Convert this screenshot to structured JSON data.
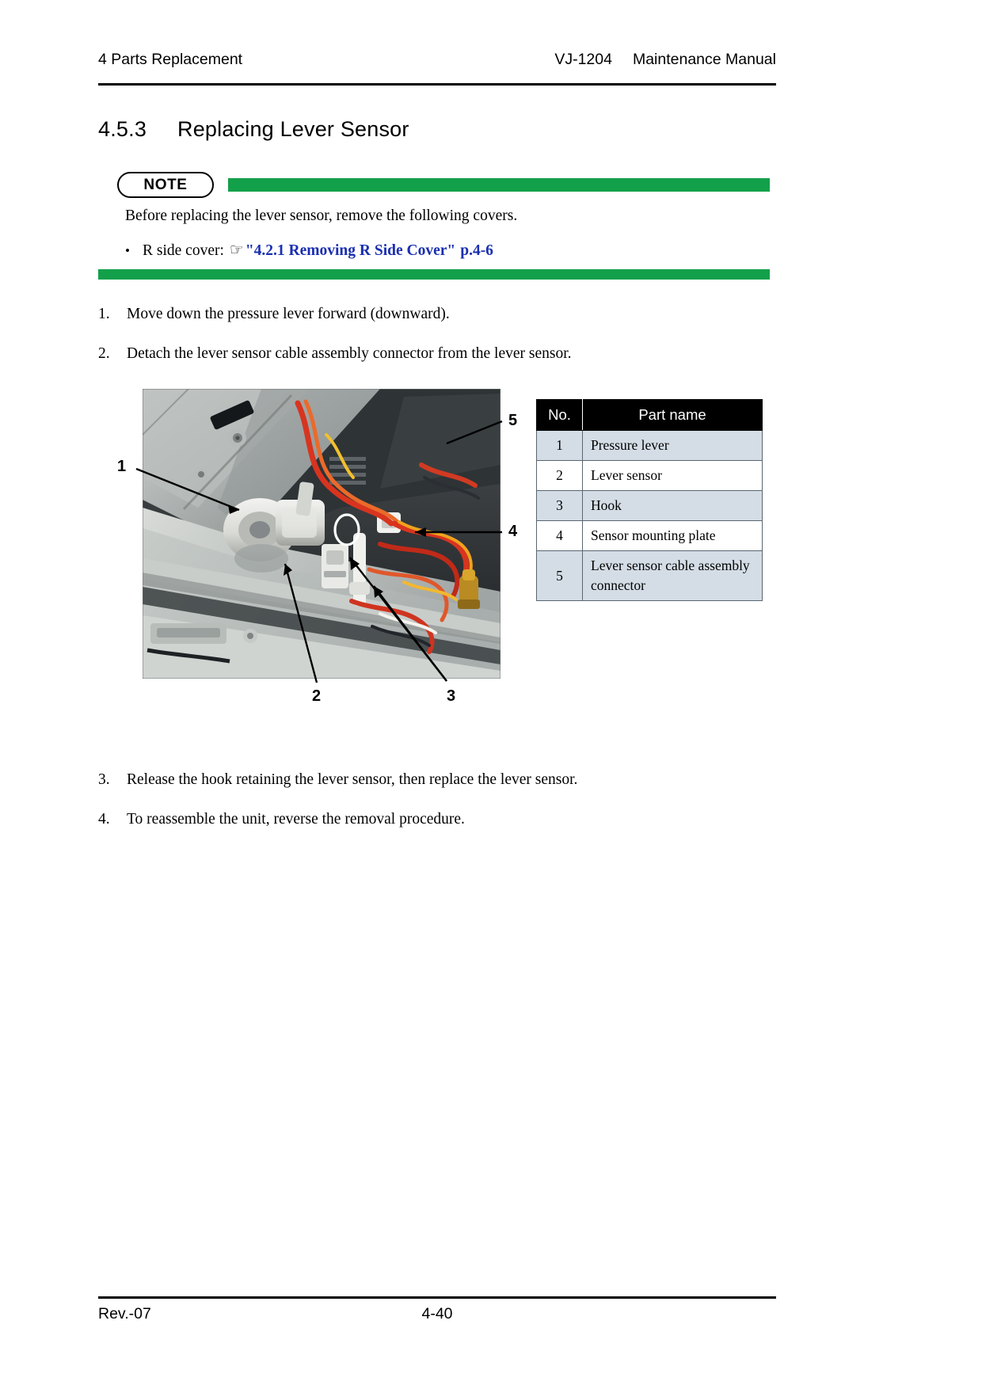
{
  "header": {
    "left": "4 Parts Replacement",
    "model": "VJ-1204",
    "manual": "Maintenance Manual"
  },
  "section": {
    "number": "4.5.3",
    "title": "Replacing Lever Sensor"
  },
  "note": {
    "badge": "NOTE",
    "bar_color": "#13a04a",
    "body": "Before replacing the lever sensor, remove the following covers.",
    "bullet_symbol": "•",
    "bullet_prefix": "R side cover:",
    "hand_icon": "☞",
    "link": "\"4.2.1 Removing R Side Cover\"",
    "link_page": "p.4-6",
    "link_color": "#1a2fb0"
  },
  "steps_upper": [
    {
      "num": "1.",
      "text": "Move down the pressure lever forward (downward)."
    },
    {
      "num": "2.",
      "text": "Detach the lever sensor cable assembly connector from the lever sensor."
    }
  ],
  "steps_lower": [
    {
      "num": "3.",
      "text": "Release the hook retaining the lever sensor, then replace the lever sensor."
    },
    {
      "num": "4.",
      "text": "To reassemble the unit, reverse the removal procedure."
    }
  ],
  "figure": {
    "callouts": [
      {
        "label": "1"
      },
      {
        "label": "2"
      },
      {
        "label": "3"
      },
      {
        "label": "4"
      },
      {
        "label": "5"
      }
    ]
  },
  "parts_table": {
    "columns": [
      "No.",
      "Part name"
    ],
    "rows": [
      {
        "no": "1",
        "name": "Pressure lever"
      },
      {
        "no": "2",
        "name": "Lever sensor"
      },
      {
        "no": "3",
        "name": "Hook"
      },
      {
        "no": "4",
        "name": "Sensor mounting plate"
      },
      {
        "no": "5",
        "name": "Lever sensor cable assembly connector"
      }
    ]
  },
  "footer": {
    "revision": "Rev.-07",
    "page": "4-40"
  }
}
